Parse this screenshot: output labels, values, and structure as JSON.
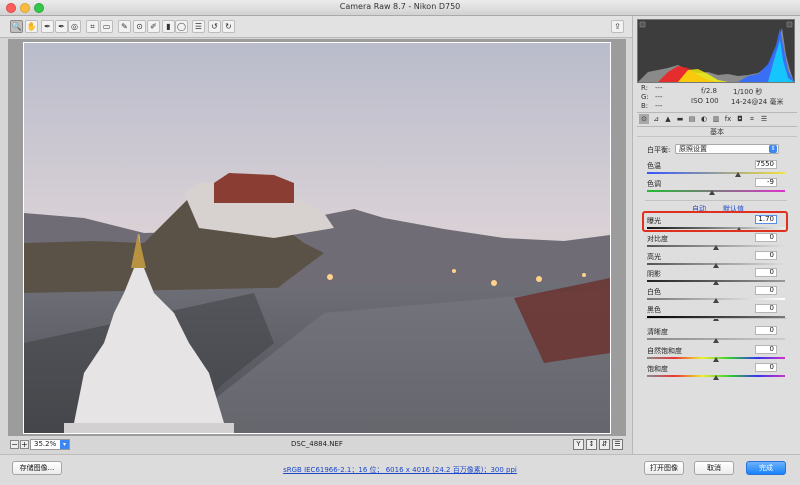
{
  "window": {
    "title": "Camera Raw 8.7 -  Nikon D750"
  },
  "toolbar": {
    "tools": [
      {
        "name": "zoom-tool",
        "glyph": "🔍"
      },
      {
        "name": "hand-tool",
        "glyph": "✋"
      },
      {
        "name": "white-balance-tool",
        "glyph": "✒"
      },
      {
        "name": "color-sampler-tool",
        "glyph": "✒"
      },
      {
        "name": "targeted-adjustment-tool",
        "glyph": "◎"
      },
      {
        "name": "crop-tool",
        "glyph": "⌗"
      },
      {
        "name": "straighten-tool",
        "glyph": "▭"
      },
      {
        "name": "spot-removal-tool",
        "glyph": "✎"
      },
      {
        "name": "red-eye-tool",
        "glyph": "⊙"
      },
      {
        "name": "adjustment-brush-tool",
        "glyph": "✐"
      },
      {
        "name": "graduated-filter-tool",
        "glyph": "▮"
      },
      {
        "name": "radial-filter-tool",
        "glyph": "◯"
      },
      {
        "name": "preferences-tool",
        "glyph": "☰"
      },
      {
        "name": "rotate-left-tool",
        "glyph": "↺"
      },
      {
        "name": "rotate-right-tool",
        "glyph": "↻"
      }
    ],
    "export_glyph": "⇪"
  },
  "preview": {
    "zoom_value": "35.2%",
    "zoom_minus": "−",
    "zoom_plus": "+",
    "filename": "DSC_4884.NEF",
    "view_glyphs": [
      "Y",
      "↕",
      "⇵",
      "☰"
    ]
  },
  "info": {
    "r_label": "R:",
    "g_label": "G:",
    "b_label": "B:",
    "r_value": "---",
    "g_value": "---",
    "b_value": "---",
    "aperture": "f/2.8",
    "shutter": "1/100 秒",
    "iso": "ISO 100",
    "lens": "14-24@24 毫米"
  },
  "panel": {
    "tab_glyphs": [
      "⊙",
      "⊿",
      "▲",
      "▬",
      "▤",
      "◐",
      "▥",
      "fx",
      "◘",
      "⌗",
      "☰"
    ],
    "section_title": "基本",
    "wb_label": "白平衡:",
    "wb_value": "原照设置",
    "auto_link": "自动",
    "default_link": "默认值",
    "sliders": [
      {
        "key": "temp",
        "label": "色温",
        "value": "7550",
        "level": 0.66
      },
      {
        "key": "tint",
        "label": "色调",
        "value": "-9",
        "level": 0.47
      },
      {
        "key": "exposure",
        "label": "曝光",
        "value": "1.70",
        "level": 0.67
      },
      {
        "key": "contrast",
        "label": "对比度",
        "value": "0",
        "level": 0.5
      },
      {
        "key": "highlights",
        "label": "高光",
        "value": "0",
        "level": 0.5
      },
      {
        "key": "shadows",
        "label": "阴影",
        "value": "0",
        "level": 0.5
      },
      {
        "key": "whites",
        "label": "白色",
        "value": "0",
        "level": 0.5
      },
      {
        "key": "blacks",
        "label": "黑色",
        "value": "0",
        "level": 0.5
      },
      {
        "key": "clarity",
        "label": "清晰度",
        "value": "0",
        "level": 0.5
      },
      {
        "key": "vibrance",
        "label": "自然饱和度",
        "value": "0",
        "level": 0.5
      },
      {
        "key": "saturation",
        "label": "饱和度",
        "value": "0",
        "level": 0.5
      }
    ]
  },
  "footer": {
    "save_label": "存储图像...",
    "workflow_text": "sRGB IEC61966-2.1；16 位；  6016 x 4016 (24.2 百万像素)；300 ppi",
    "open_label": "打开图像",
    "cancel_label": "取消",
    "done_label": "完成"
  },
  "colors": {
    "accent": "#1a82fb",
    "highlight_box": "#e03020"
  }
}
